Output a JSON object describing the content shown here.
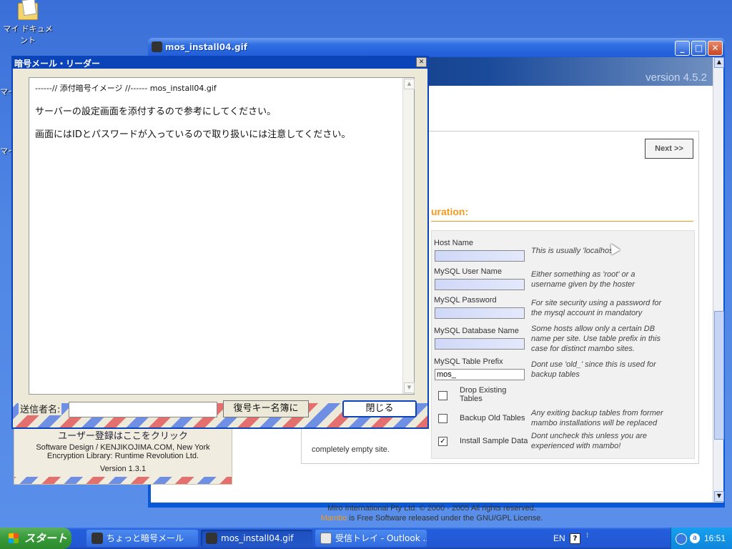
{
  "desktop": {
    "icons": [
      {
        "label": "マイ ドキュメント",
        "icon": "my-documents-icon"
      }
    ],
    "partial_labels": [
      "マイ",
      "マイ"
    ]
  },
  "back_window": {
    "title": "mos_install04.gif",
    "version_text": "version 4.5.2",
    "next_button": "Next >>",
    "section_title": "uration:",
    "fields": [
      {
        "label": "Host Name",
        "value": "",
        "note": "This is usually 'localhost'"
      },
      {
        "label": "MySQL User Name",
        "value": "",
        "note": "Either something as 'root' or a username given by the hoster"
      },
      {
        "label": "MySQL Password",
        "value": "",
        "note": "For site security using a password for the mysql account in mandatory"
      },
      {
        "label": "MySQL Database Name",
        "value": "",
        "note": "Some hosts allow only a certain DB name per site. Use table prefix in this case for distinct mambo sites."
      },
      {
        "label": "MySQL Table Prefix",
        "value": "mos_",
        "note": "Dont use 'old_' since this is used for backup tables"
      }
    ],
    "checkboxes": [
      {
        "label": "Drop Existing Tables",
        "checked": false,
        "note": ""
      },
      {
        "label": "Backup Old Tables",
        "checked": false,
        "note": "Any exiting backup tables from former mambo installations will be replaced"
      },
      {
        "label": "Install Sample Data",
        "checked": true,
        "note": "Dont uncheck this unless you are experienced with mambo!"
      }
    ],
    "empty_site_text": "completely empty site.",
    "footer_line1": "Miro International Pty Ltd. © 2000 - 2005 All rights reserved.",
    "footer_line2_link": "Mambo",
    "footer_line2_rest": " is Free Software released under the GNU/GPL License."
  },
  "registration_panel": {
    "title": "ユーザー登録はここをクリック",
    "line1": "Software Design / KENJIKOJIMA.COM, New York",
    "line2": "Encryption Library: Runtime Revolution Ltd.",
    "version": "Version 1.3.1"
  },
  "front_window": {
    "title": "暗号メール・リーダー",
    "message": {
      "attachment_line": "------// 添付暗号イメージ //------ mos_install04.gif",
      "line1": "サーバーの設定画面を添付するので参考にしてください。",
      "line2": "画面にはIDとパスワードが入っているので取り扱いには注意してください。"
    },
    "sender_label": "送信者名:",
    "sender_value": "",
    "decrypt_key_button": "復号キー名簿に",
    "close_button": "閉じる"
  },
  "taskbar": {
    "start_label": "スタート",
    "buttons": [
      {
        "label": "ちょっと暗号メール",
        "icon": "app-icon",
        "active": false
      },
      {
        "label": "mos_install04.gif",
        "icon": "app-icon",
        "active": true
      },
      {
        "label": "受信トレイ - Outlook ...",
        "icon": "outlook-icon",
        "active": false
      }
    ],
    "language": "EN",
    "clock": "16:51"
  }
}
